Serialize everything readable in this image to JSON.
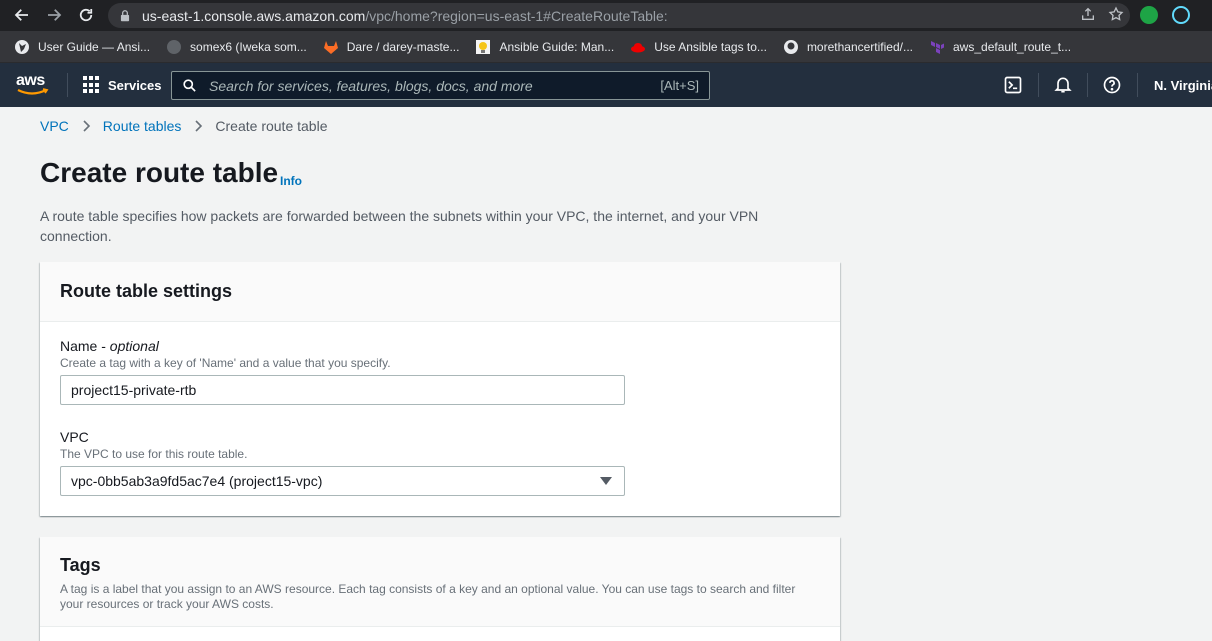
{
  "browser": {
    "url_host": "us-east-1.console.aws.amazon.com",
    "url_path": "/vpc/home?region=us-east-1#CreateRouteTable:",
    "bookmarks": [
      {
        "label": "User Guide — Ansi..."
      },
      {
        "label": "somex6 (Iweka som..."
      },
      {
        "label": "Dare / darey-maste..."
      },
      {
        "label": "Ansible Guide: Man..."
      },
      {
        "label": "Use Ansible tags to..."
      },
      {
        "label": "morethancertified/..."
      },
      {
        "label": "aws_default_route_t..."
      }
    ]
  },
  "aws_nav": {
    "logo_text": "aws",
    "services_label": "Services",
    "search_placeholder": "Search for services, features, blogs, docs, and more",
    "search_shortcut": "[Alt+S]",
    "region": "N. Virginia"
  },
  "breadcrumb": {
    "items": [
      "VPC",
      "Route tables"
    ],
    "current": "Create route table"
  },
  "page": {
    "title": "Create route table",
    "info_label": "Info",
    "description": "A route table specifies how packets are forwarded between the subnets within your VPC, the internet, and your VPN connection."
  },
  "settings_panel": {
    "title": "Route table settings",
    "name_label": "Name - ",
    "name_optional": "optional",
    "name_desc": "Create a tag with a key of 'Name' and a value that you specify.",
    "name_value": "project15-private-rtb",
    "vpc_label": "VPC",
    "vpc_desc": "The VPC to use for this route table.",
    "vpc_value": "vpc-0bb5ab3a9fd5ac7e4 (project15-vpc)"
  },
  "tags_panel": {
    "title": "Tags",
    "description": "A tag is a label that you assign to an AWS resource. Each tag consists of a key and an optional value. You can use tags to search and filter your resources or track your AWS costs."
  }
}
